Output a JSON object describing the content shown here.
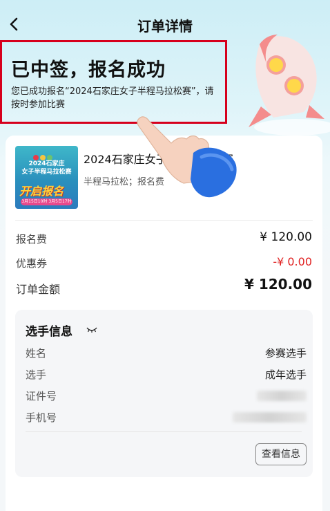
{
  "header": {
    "title": "订单详情",
    "back_icon": "chevron-left-icon"
  },
  "status": {
    "title": "已中签，报名成功",
    "description": "您已成功报名“2024石家庄女子半程马拉松赛”，请按时参加比赛"
  },
  "event": {
    "name": "2024石家庄女子半程马拉松赛",
    "tags": "半程马拉松；报名费",
    "image": {
      "line1": "2024石家庄",
      "line2": "女子半程马拉松赛",
      "line3": "开启报名",
      "line4": "3月15日10时 3月5日17时"
    }
  },
  "fees": {
    "fee_label": "报名费",
    "fee_value": "¥ 120.00",
    "coupon_label": "优惠券",
    "coupon_value": "-¥ 0.00",
    "total_label": "订单金额",
    "total_value": "¥ 120.00"
  },
  "player": {
    "title": "选手信息",
    "name_label": "姓名",
    "name_value": "参赛选手",
    "type_label": "选手",
    "type_value": "成年选手",
    "id_label": "证件号",
    "phone_label": "手机号",
    "view_button": "查看信息"
  },
  "colors": {
    "highlight_border": "#d6001c",
    "coupon_red": "#e02020",
    "accent_blue": "#2a6fe0"
  }
}
